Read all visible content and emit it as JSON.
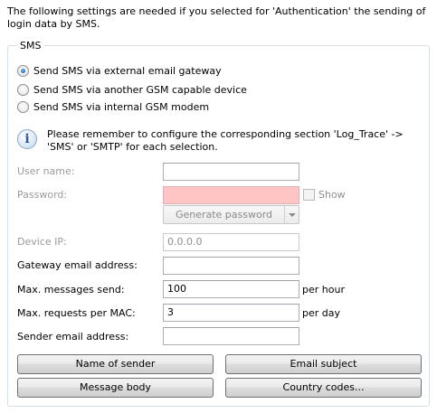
{
  "intro_text": "The following settings are needed if you selected for 'Authentication' the sending of login data by SMS.",
  "group_title": "SMS",
  "sms_options": [
    {
      "label": "Send SMS via external email gateway",
      "checked": true
    },
    {
      "label": "Send SMS via another GSM capable device",
      "checked": false
    },
    {
      "label": "Send SMS via internal GSM modem",
      "checked": false
    }
  ],
  "info": {
    "icon": "info-icon",
    "text": "Please remember to configure the corresponding section 'Log_Trace' -> 'SMS' or 'SMTP' for each selection."
  },
  "fields": {
    "user_name": {
      "label": "User name:",
      "value": ""
    },
    "password": {
      "label": "Password:",
      "value": "",
      "show_label": "Show",
      "show_checked": false
    },
    "generate_password": "Generate password",
    "device_ip": {
      "label": "Device IP:",
      "value": "0.0.0.0"
    },
    "gateway_email": {
      "label": "Gateway email address:",
      "value": ""
    },
    "max_messages": {
      "label": "Max. messages send:",
      "value": "100",
      "suffix": "per hour"
    },
    "max_requests": {
      "label": "Max. requests per MAC:",
      "value": "3",
      "suffix": "per day"
    },
    "sender_email": {
      "label": "Sender email address:",
      "value": ""
    }
  },
  "buttons": {
    "name_of_sender": "Name of sender",
    "email_subject": "Email subject",
    "message_body": "Message body",
    "country_codes": "Country codes..."
  },
  "colors": {
    "password_error_bg": "#ffc4c4",
    "radio_accent": "#1f5fa8"
  }
}
